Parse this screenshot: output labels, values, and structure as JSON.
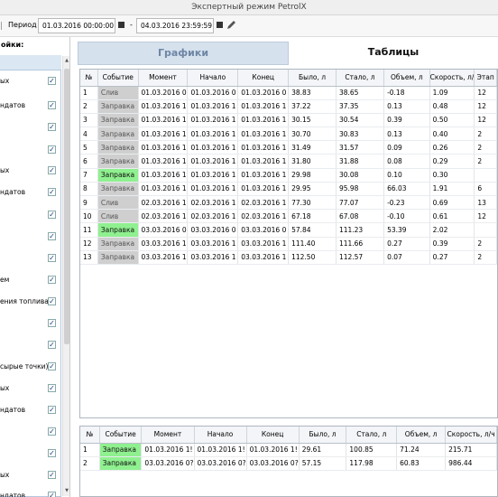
{
  "window": {
    "title": "Экспертный режим PetrolX"
  },
  "toolbar": {
    "period_label": "Период",
    "start": "01.03.2016 00:00:00",
    "end": "04.03.2016 23:59:59",
    "separator": "-"
  },
  "left_panel": {
    "title": "ойки:",
    "items": [
      {
        "label": "ых",
        "checked": true
      },
      {
        "label": "ндатов",
        "checked": true
      },
      {
        "label": "",
        "checked": true
      },
      {
        "label": "",
        "checked": true
      },
      {
        "label": "ых",
        "checked": true
      },
      {
        "label": "ндатов",
        "checked": true
      },
      {
        "label": "",
        "checked": true
      },
      {
        "label": "",
        "checked": true
      },
      {
        "label": "",
        "checked": true
      },
      {
        "label": "ем",
        "checked": true
      },
      {
        "label": "ения топлива",
        "checked": true
      },
      {
        "label": "",
        "checked": true
      },
      {
        "label": "",
        "checked": true
      },
      {
        "label": "сырые точки)",
        "checked": true
      },
      {
        "label": "ых",
        "checked": true
      },
      {
        "label": "ндатов",
        "checked": true
      },
      {
        "label": "",
        "checked": true
      },
      {
        "label": "",
        "checked": true
      },
      {
        "label": "ых",
        "checked": true
      },
      {
        "label": "ндатов",
        "checked": true
      }
    ]
  },
  "tabs": [
    {
      "label": "Графики",
      "active": false
    },
    {
      "label": "Таблицы",
      "active": true
    }
  ],
  "events_table": {
    "columns": [
      "№",
      "Событие",
      "Момент",
      "Начало",
      "Конец",
      "Было, л",
      "Стало, л",
      "Объем, л",
      "Скорость, л/",
      "Этап"
    ],
    "rows": [
      [
        "1",
        "Слив",
        "01.03.2016 0",
        "01.03.2016 0",
        "01.03.2016 0",
        "38.83",
        "38.65",
        "-0.18",
        "1.09",
        "12"
      ],
      [
        "2",
        "Заправка",
        "01.03.2016 1",
        "01.03.2016 1",
        "01.03.2016 1",
        "37.22",
        "37.35",
        "0.13",
        "0.48",
        "12"
      ],
      [
        "3",
        "Заправка",
        "01.03.2016 1",
        "01.03.2016 1",
        "01.03.2016 1",
        "30.15",
        "30.54",
        "0.39",
        "0.50",
        "12"
      ],
      [
        "4",
        "Заправка",
        "01.03.2016 1",
        "01.03.2016 1",
        "01.03.2016 1",
        "30.70",
        "30.83",
        "0.13",
        "0.40",
        "2"
      ],
      [
        "5",
        "Заправка",
        "01.03.2016 1",
        "01.03.2016 1",
        "01.03.2016 1",
        "31.49",
        "31.57",
        "0.09",
        "0.26",
        "2"
      ],
      [
        "6",
        "Заправка",
        "01.03.2016 1",
        "01.03.2016 1",
        "01.03.2016 1",
        "31.80",
        "31.88",
        "0.08",
        "0.29",
        "2"
      ],
      [
        "7",
        "Заправка",
        "01.03.2016 1",
        "01.03.2016 1",
        "01.03.2016 1",
        "29.98",
        "30.08",
        "0.10",
        "0.30",
        ""
      ],
      [
        "8",
        "Заправка",
        "01.03.2016 1",
        "01.03.2016 1",
        "01.03.2016 1",
        "29.95",
        "95.98",
        "66.03",
        "1.91",
        "6"
      ],
      [
        "9",
        "Слив",
        "02.03.2016 1",
        "02.03.2016 1",
        "02.03.2016 1",
        "77.30",
        "77.07",
        "-0.23",
        "0.69",
        "13"
      ],
      [
        "10",
        "Слив",
        "02.03.2016 1",
        "02.03.2016 1",
        "02.03.2016 1",
        "67.18",
        "67.08",
        "-0.10",
        "0.61",
        "12"
      ],
      [
        "11",
        "Заправка",
        "03.03.2016 0",
        "03.03.2016 0",
        "03.03.2016 0",
        "57.84",
        "111.23",
        "53.39",
        "2.02",
        ""
      ],
      [
        "12",
        "Заправка",
        "03.03.2016 1",
        "03.03.2016 1",
        "03.03.2016 1",
        "111.40",
        "111.66",
        "0.27",
        "0.39",
        "2"
      ],
      [
        "13",
        "Заправка",
        "03.03.2016 1",
        "03.03.2016 1",
        "03.03.2016 1",
        "112.50",
        "112.57",
        "0.07",
        "0.27",
        "2"
      ]
    ],
    "highlighted_rows": [
      7,
      11
    ]
  },
  "summary_table": {
    "columns": [
      "№",
      "Событие",
      "Момент",
      "Начало",
      "Конец",
      "Было, л",
      "Стало, л",
      "Объем, л",
      "Скорость, л/ч"
    ],
    "rows": [
      [
        "1",
        "Заправка",
        "01.03.2016 1!",
        "01.03.2016 1!",
        "01.03.2016 1!",
        "29.61",
        "100.85",
        "71.24",
        "215.71"
      ],
      [
        "2",
        "Заправка",
        "03.03.2016 0?",
        "03.03.2016 0?",
        "03.03.2016 0?",
        "57.15",
        "117.98",
        "60.83",
        "986.44"
      ]
    ]
  },
  "colors": {
    "highlight_green": "#8ff08f",
    "inactive_event": "#cfcfcf",
    "tab_inactive": "#d6e1ee"
  }
}
